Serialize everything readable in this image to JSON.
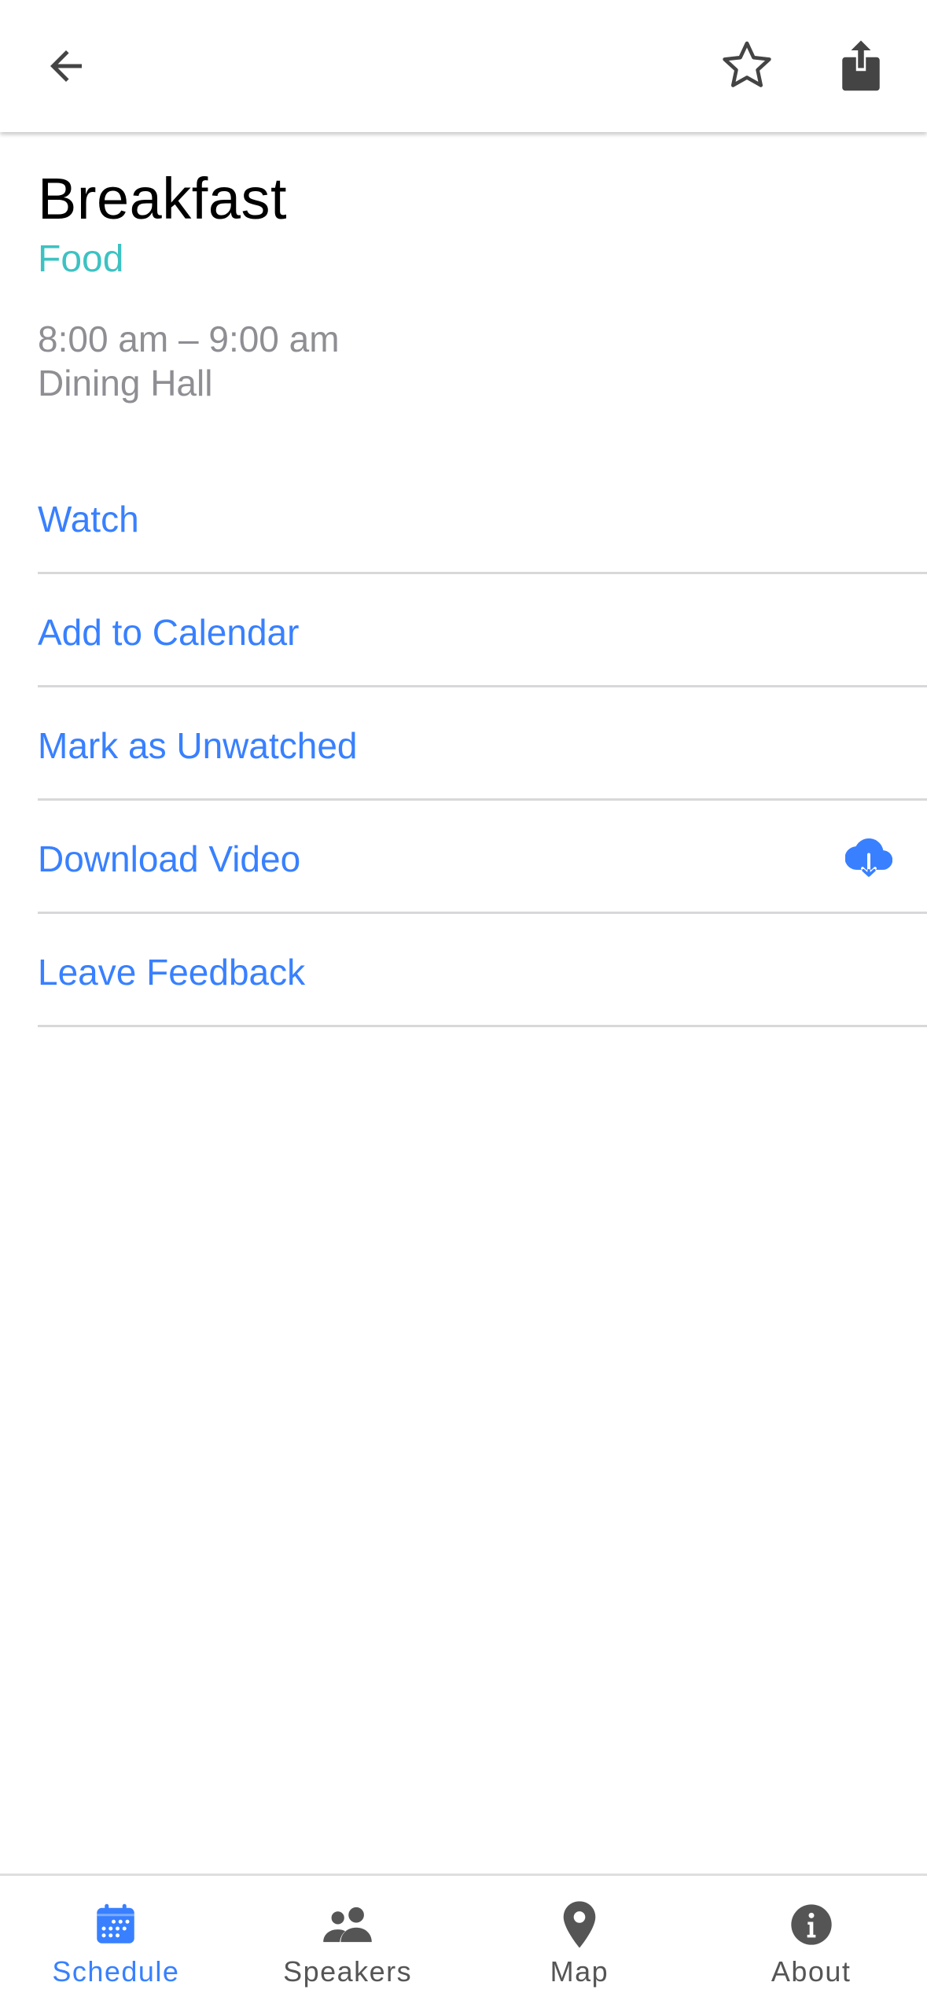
{
  "colors": {
    "accent": "#3880ff",
    "track_food": "#3dc2c2",
    "secondary_text": "#8e8e93",
    "icon_dark": "#444444",
    "tab_inactive": "#555555"
  },
  "toolbar": {
    "back_icon": "arrow-back-icon",
    "favorite_icon": "star-outline-icon",
    "share_icon": "share-icon"
  },
  "session": {
    "title": "Breakfast",
    "track": "Food",
    "time": "8:00 am – 9:00 am",
    "location": "Dining Hall"
  },
  "actions": [
    {
      "label": "Watch"
    },
    {
      "label": "Add to Calendar"
    },
    {
      "label": "Mark as Unwatched"
    },
    {
      "label": "Download Video",
      "icon": "cloud-download-icon"
    },
    {
      "label": "Leave Feedback"
    }
  ],
  "tabs": [
    {
      "label": "Schedule",
      "icon": "calendar-icon",
      "selected": true
    },
    {
      "label": "Speakers",
      "icon": "people-icon",
      "selected": false
    },
    {
      "label": "Map",
      "icon": "location-pin-icon",
      "selected": false
    },
    {
      "label": "About",
      "icon": "info-icon",
      "selected": false
    }
  ]
}
